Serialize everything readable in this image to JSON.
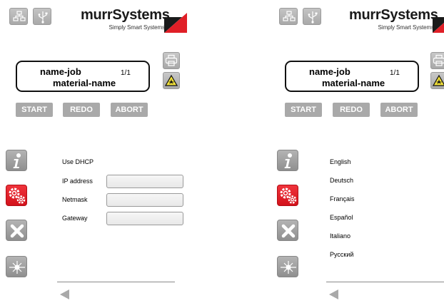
{
  "logo": {
    "name": "murrSystems",
    "tagline": "Simply Smart Systems"
  },
  "job": {
    "name": "name-job",
    "count": "1/1",
    "material": "material-name"
  },
  "actions": {
    "start": "START",
    "redo": "REDO",
    "abort": "ABORT"
  },
  "network": {
    "dhcp_label": "Use DHCP",
    "ip_label": "IP address",
    "ip_value": "",
    "netmask_label": "Netmask",
    "netmask_value": "",
    "gateway_label": "Gateway",
    "gateway_value": ""
  },
  "languages": [
    "English",
    "Deutsch",
    "Français",
    "Español",
    "Italiano",
    "Русский"
  ],
  "icons": {
    "network": "network-icon",
    "usb": "usb-icon",
    "printer": "printer-icon",
    "laser_warning": "laser-warning-icon",
    "info": "info-icon",
    "settings": "gears-icon",
    "close": "close-icon",
    "laser": "laser-icon",
    "back": "back-arrow-icon"
  },
  "colors": {
    "accent_red": "#e01f27",
    "button_gray": "#a9a9a9"
  }
}
